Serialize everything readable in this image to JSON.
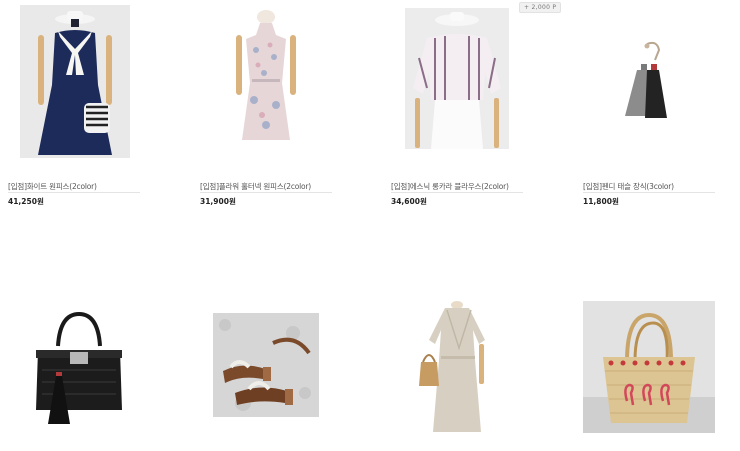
{
  "point_badge": "+ 2,000 P",
  "products": [
    {
      "name": "[입점]화이트 원피스(2color)",
      "price": "41,250원",
      "image": "navy-dress-with-white-scarf"
    },
    {
      "name": "[입점]플라워 홀터넥 원피스(2color)",
      "price": "31,900원",
      "image": "floral-halter-dress"
    },
    {
      "name": "[입점]에스닉 롱카라 블라우스(2color)",
      "price": "34,600원",
      "image": "striped-blouse-white-skirt"
    },
    {
      "name": "[입점]펜디 태슬 장식(3color)",
      "price": "11,800원",
      "image": "tassel-keychain"
    },
    {
      "name": "",
      "price": "",
      "image": "black-handbag-with-tassel"
    },
    {
      "name": "",
      "price": "",
      "image": "brown-strap-sandals"
    },
    {
      "name": "",
      "price": "",
      "image": "beige-wrap-dress"
    },
    {
      "name": "",
      "price": "",
      "image": "flamingo-straw-basket-bag"
    }
  ]
}
